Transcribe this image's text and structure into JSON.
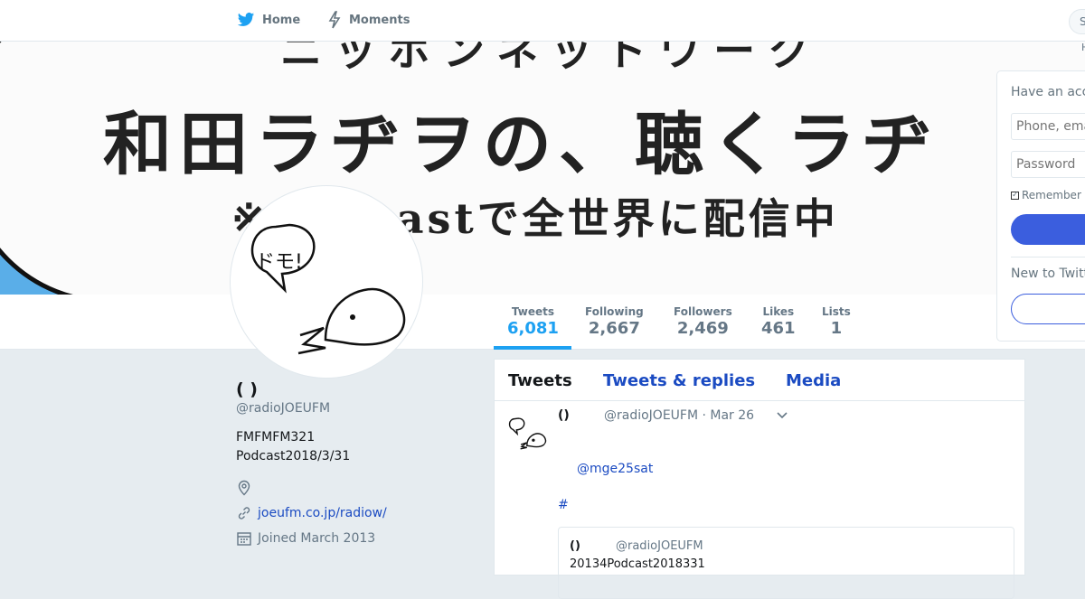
{
  "nav": {
    "home_label": "Home",
    "moments_label": "Moments",
    "search_placeholder": "S"
  },
  "banner": {
    "line1": "ニッポンネットワーク",
    "line2": "和田ラヂヲの、聴くラヂ",
    "line3": "※Podcastで全世界に配信中"
  },
  "side_label": "H",
  "stats": [
    {
      "label": "Tweets",
      "value": "6,081",
      "active": true
    },
    {
      "label": "Following",
      "value": "2,667"
    },
    {
      "label": "Followers",
      "value": "2,469"
    },
    {
      "label": "Likes",
      "value": "461"
    },
    {
      "label": "Lists",
      "value": "1"
    }
  ],
  "login": {
    "heading": "Have an acc",
    "phone_placeholder": "Phone, ema",
    "password_placeholder": "Password",
    "remember_label": "Remember",
    "new_to": "New to Twitt"
  },
  "profile": {
    "name": "(                    )",
    "handle": "@radioJOEUFM",
    "bio_line1": "FMFMFM321",
    "bio_line2": "Podcast2018/3/31",
    "location": "",
    "website": "joeufm.co.jp/radiow/",
    "joined": "Joined March 2013"
  },
  "timeline": {
    "tabs": [
      "Tweets",
      "Tweets & replies",
      "Media"
    ],
    "tweet": {
      "name": "()",
      "handle_date": "@radioJOEUFM  · Mar 26",
      "mention": "@mge25sat",
      "hashtag": "#",
      "quote": {
        "name": "()",
        "handle": "@radioJOEUFM",
        "text": "20134Podcast2018331"
      }
    }
  },
  "colors": {
    "twitter_blue": "#1da1f2",
    "link_blue": "#1b4bc2",
    "button_blue": "#3b5ede",
    "banner_blue": "#5aaee8"
  }
}
